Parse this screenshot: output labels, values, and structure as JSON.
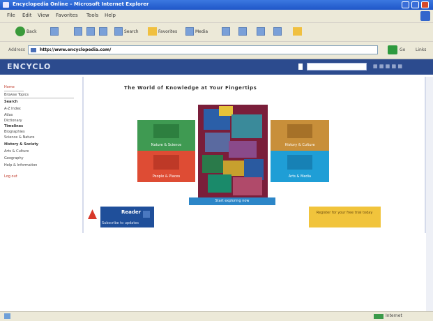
{
  "window": {
    "title": "Encyclopedia Online – Microsoft Internet Explorer"
  },
  "menu": {
    "items": [
      "File",
      "Edit",
      "View",
      "Favorites",
      "Tools",
      "Help"
    ]
  },
  "toolbar": {
    "back_label": "Back",
    "forward_label": "",
    "search_label": "Search",
    "favorites_label": "Favorites",
    "media_label": "Media"
  },
  "address": {
    "label": "Address",
    "url": "http://www.encyclopedia.com/",
    "go_label": "Go",
    "links_label": "Links"
  },
  "site": {
    "logo": "ENCYCLO",
    "search_placeholder": ""
  },
  "nav": {
    "items": [
      {
        "label": "Home",
        "style": "red"
      },
      {
        "label": "Browse Topics",
        "style": "normal"
      },
      {
        "label": "Search",
        "style": "bold"
      },
      {
        "label": "A-Z Index",
        "style": "normal"
      },
      {
        "label": "Atlas",
        "style": "normal"
      },
      {
        "label": "Dictionary",
        "style": "normal"
      },
      {
        "label": "Timelines",
        "style": "bold"
      },
      {
        "label": "Biographies",
        "style": "normal"
      },
      {
        "label": "Science & Nature",
        "style": "normal"
      },
      {
        "label": "History & Society",
        "style": "bold"
      },
      {
        "label": "Arts & Culture",
        "style": "normal"
      },
      {
        "label": "Geography",
        "style": "normal"
      },
      {
        "label": "Help & Information",
        "style": "normal"
      },
      {
        "label": "Log out",
        "style": "red"
      }
    ]
  },
  "main": {
    "heading": "The World of Knowledge at Your Fingertips",
    "covers": {
      "green_caption": "Nature & Science",
      "red_caption": "People & Places",
      "gold_caption": "History & Culture",
      "blue_caption": "Arts & Media"
    },
    "feature_caption": "Start exploring now",
    "left_banner": {
      "title": "Reader",
      "caption": "Subscribe to updates"
    },
    "right_banner_text": "Register for your free trial today"
  },
  "status": {
    "zone_label": "Internet"
  },
  "colors": {
    "titlebar": "#1f56c8",
    "site_header": "#2c4b8e",
    "accent_red": "#c03a2a"
  }
}
